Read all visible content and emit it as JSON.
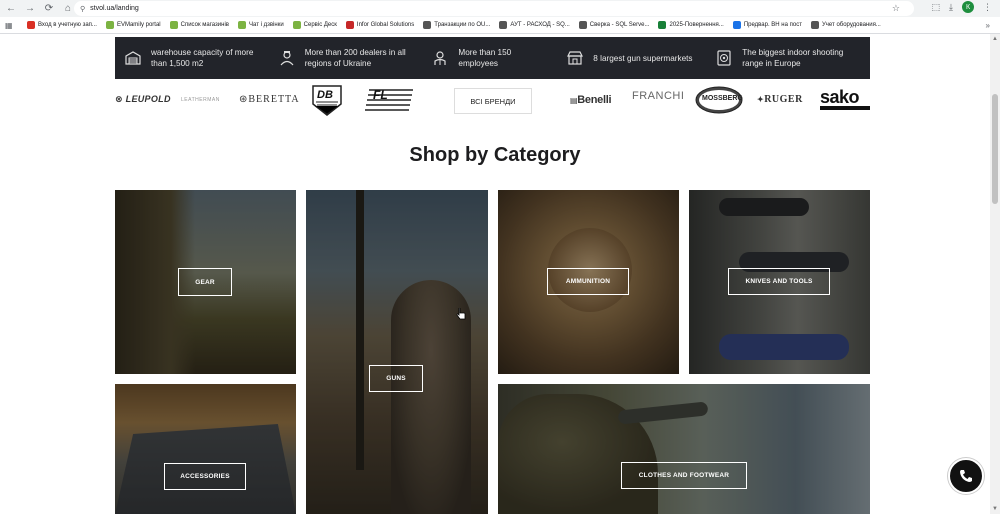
{
  "browser": {
    "url": "stvol.ua/landing",
    "bookmarks": [
      {
        "label": "Вход в учетную зап...",
        "color": "#d93025"
      },
      {
        "label": "EVMamily portal",
        "color": "#7cb342"
      },
      {
        "label": "Список магазинів",
        "color": "#7cb342"
      },
      {
        "label": "Чат і дзвінки",
        "color": "#7cb342"
      },
      {
        "label": "Сервіс Деск",
        "color": "#7cb342"
      },
      {
        "label": "Infor Global Solutions",
        "color": "#c62828"
      },
      {
        "label": "Транзакции по OU...",
        "color": "#555555"
      },
      {
        "label": "АУТ - РАСХОД - SQ...",
        "color": "#555555"
      },
      {
        "label": "Сверка - SQL Serve...",
        "color": "#555555"
      },
      {
        "label": "2025-Повернення...",
        "color": "#188038"
      },
      {
        "label": "Предвар. ВН на пост",
        "color": "#1a73e8"
      },
      {
        "label": "Учет оборудования...",
        "color": "#555555"
      }
    ],
    "avatar_letter": "К"
  },
  "stats": [
    {
      "text": "warehouse capacity of more than 1,500 m2",
      "icon": "warehouse-icon"
    },
    {
      "text": "More than 200 dealers in all regions of Ukraine",
      "icon": "dealer-icon"
    },
    {
      "text": "More than 150 employees",
      "icon": "employee-icon"
    },
    {
      "text": "8 largest gun supermarkets",
      "icon": "store-icon"
    },
    {
      "text": "The biggest indoor shooting range in Europe",
      "icon": "target-icon"
    }
  ],
  "brands": {
    "leupold": "LEUPOLD",
    "leatherman": "LEATHERMAN",
    "beretta": "BERETTA",
    "db": "DB",
    "flag": "FL",
    "all_brands": "ВСІ БРЕНДИ",
    "benelli": "Benelli",
    "franchi": "FRANCHI",
    "mossberg": "MOSSBERG",
    "ruger": "RUGER",
    "sako": "sako"
  },
  "section_title": "Shop by Category",
  "categories": {
    "gear": "GEAR",
    "guns": "GUNS",
    "ammunition": "AMMUNITION",
    "knives": "KNIVES AND TOOLS",
    "accessories": "ACCESSORIES",
    "clothes": "CLOTHES AND FOOTWEAR"
  }
}
